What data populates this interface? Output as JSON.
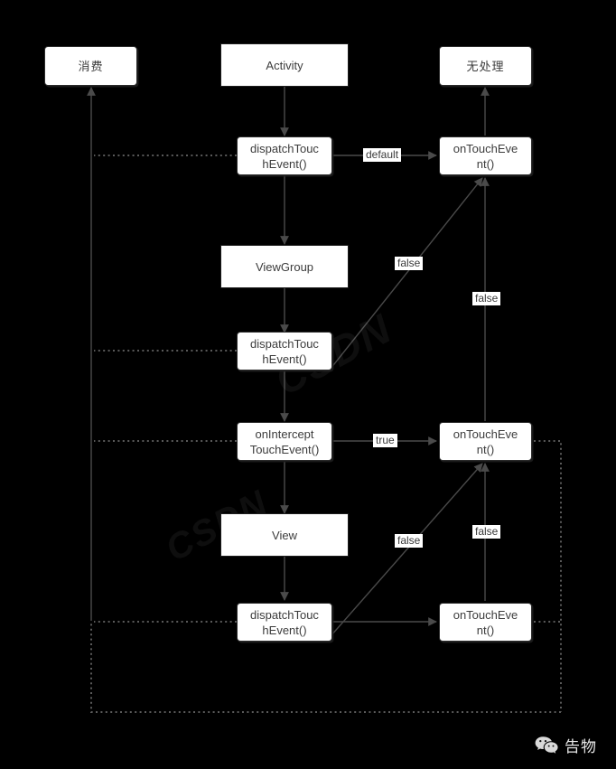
{
  "diagram": {
    "title": "Android Touch Event Dispatch Flow",
    "background_color": "#000000",
    "node_fill": "#ffffff",
    "node_text_color": "#3c3c3c",
    "edge_color": "#4a4a4a"
  },
  "nodes": {
    "consume": {
      "label": "消费"
    },
    "activity": {
      "label": "Activity"
    },
    "no_handle": {
      "label": "无处理"
    },
    "activity_dispatch": {
      "label": "dispatchTouc\nhEvent()"
    },
    "activity_ontouch": {
      "label": "onTouchEve\nnt()"
    },
    "viewgroup": {
      "label": "ViewGroup"
    },
    "viewgroup_dispatch": {
      "label": "dispatchTouc\nhEvent()"
    },
    "on_intercept": {
      "label": "onIntercept\nTouchEvent()"
    },
    "viewgroup_ontouch": {
      "label": "onTouchEve\nnt()"
    },
    "view": {
      "label": "View"
    },
    "view_dispatch": {
      "label": "dispatchTouc\nhEvent()"
    },
    "view_ontouch": {
      "label": "onTouchEve\nnt()"
    }
  },
  "edge_labels": {
    "default": "default",
    "false_vg_up": "false",
    "false_activity_ontouch": "false",
    "true_intercept": "true",
    "false_view_up": "false",
    "false_vg_ontouch": "false"
  },
  "brand": {
    "name": "告物",
    "icon": "wechat-icon"
  },
  "watermarks": [
    {
      "text": "CSDN"
    },
    {
      "text": "CSDN"
    }
  ]
}
